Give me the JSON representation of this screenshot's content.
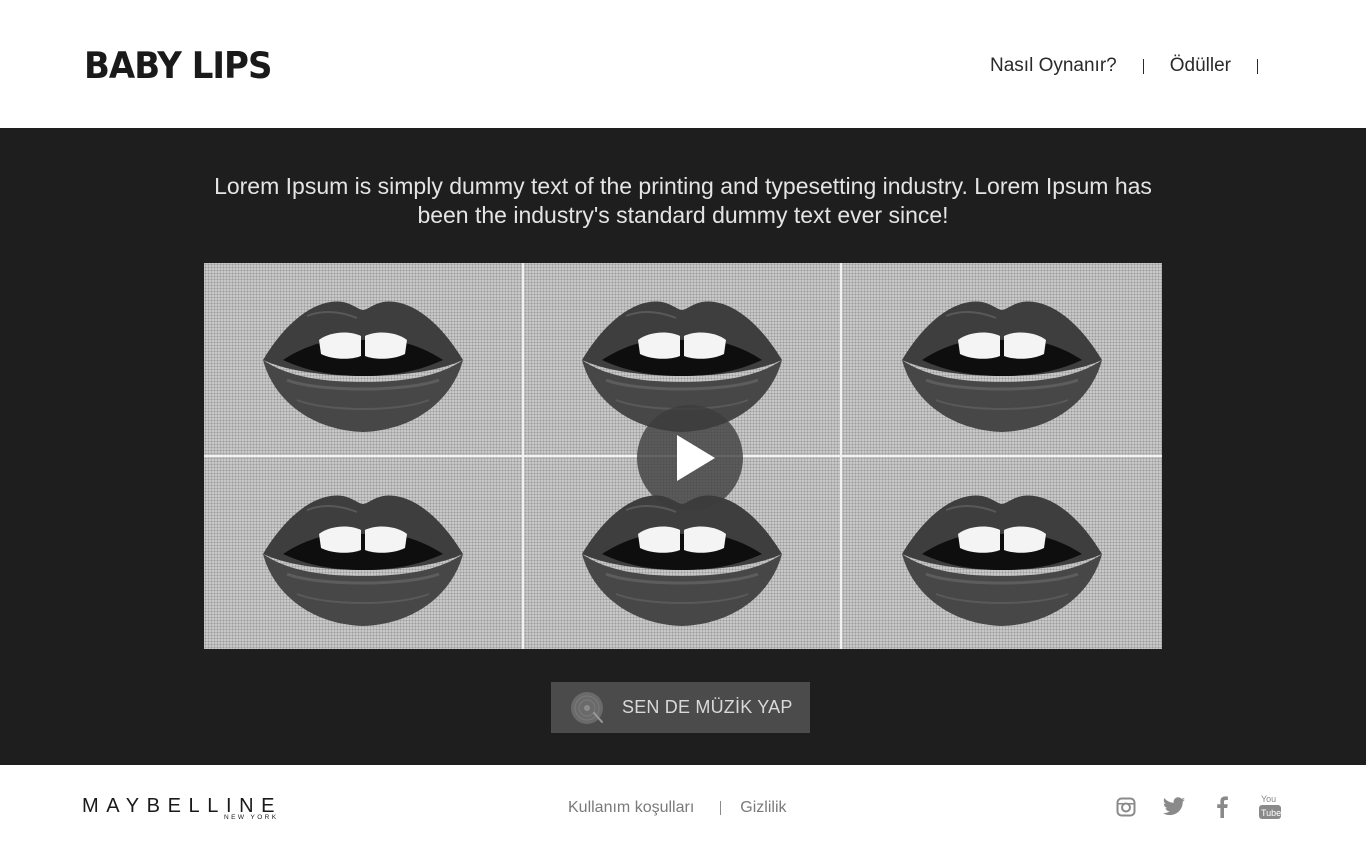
{
  "header": {
    "logo_text": "BABY LIPS",
    "nav": [
      {
        "label": "Nasıl Oynanır?"
      },
      {
        "label": "Ödüller"
      }
    ]
  },
  "main": {
    "intro_text": "Lorem Ipsum is simply dummy text of the printing and typesetting industry. Lorem Ipsum has been the industry's standard dummy text ever since!",
    "video": {
      "play_icon": "play-icon",
      "tiles": 6
    },
    "cta": {
      "label": "SEN DE MÜZİK YAP",
      "icon": "vinyl-disc-icon"
    }
  },
  "footer": {
    "brand_name": "MAYBELLINE",
    "brand_sub": "NEW YORK",
    "links": [
      {
        "label": "Kullanım koşulları"
      },
      {
        "label": "Gizlilik"
      }
    ],
    "social": [
      "instagram-icon",
      "twitter-icon",
      "facebook-icon",
      "youtube-icon"
    ]
  },
  "colors": {
    "dark_band": "#1e1e1e",
    "cta_bg": "#4b4b4b",
    "footer_link": "#7a7a7a"
  }
}
